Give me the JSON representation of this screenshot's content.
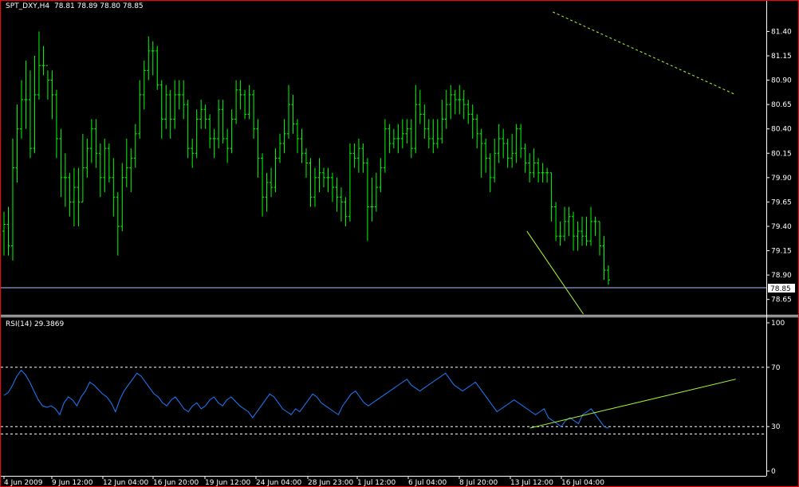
{
  "chart_data": [
    {
      "type": "bar",
      "subtype": "ohlc-bars",
      "header": {
        "symbol": "SPT_DXY,H4",
        "ohlc": "78.81 78.89 78.80 78.85"
      },
      "ylim": [
        78.5,
        81.6
      ],
      "y_ticks": [
        "81.40",
        "81.15",
        "80.90",
        "80.65",
        "80.40",
        "80.15",
        "79.90",
        "79.65",
        "79.40",
        "79.15",
        "78.90",
        "78.65"
      ],
      "current_price": "78.85",
      "series": [
        {
          "values": [
            79.42,
            79.2,
            80.0,
            80.4,
            80.7,
            80.7,
            80.2,
            80.75,
            81.05,
            81.05,
            80.9,
            80.75,
            80.3,
            79.9,
            79.9,
            79.65,
            79.8,
            79.65,
            80.0,
            80.2,
            80.4,
            80.15,
            79.9,
            80.2,
            79.9,
            79.7,
            79.4,
            79.9,
            80.0,
            80.1,
            80.35,
            80.75,
            81.0,
            81.2,
            81.2,
            80.85,
            80.5,
            80.75,
            80.5,
            80.75,
            80.75,
            80.65,
            80.2,
            80.15,
            80.5,
            80.6,
            80.5,
            80.3,
            80.3,
            80.6,
            80.3,
            80.2,
            80.5,
            80.8,
            80.75,
            80.55,
            80.75,
            80.4,
            80.1,
            79.7,
            79.85,
            79.8,
            80.1,
            80.25,
            80.35,
            80.65,
            80.45,
            80.3,
            80.15,
            80.05,
            79.7,
            79.9,
            79.95,
            79.9,
            79.9,
            79.8,
            79.7,
            79.65,
            79.5,
            80.15,
            80.1,
            80.2,
            80.05,
            79.6,
            79.6,
            79.8,
            80.0,
            80.4,
            80.25,
            80.3,
            80.3,
            80.35,
            80.4,
            80.2,
            80.65,
            80.55,
            80.4,
            80.3,
            80.25,
            80.3,
            80.5,
            80.65,
            80.75,
            80.7,
            80.7,
            80.65,
            80.55,
            80.5,
            80.35,
            80.25,
            80.1,
            79.9,
            80.15,
            80.3,
            80.25,
            80.1,
            80.15,
            80.4,
            80.2,
            80.05,
            79.95,
            80.05,
            79.95,
            79.95,
            79.95,
            79.6,
            79.3,
            79.3,
            79.45,
            79.5,
            79.3,
            79.35,
            79.3,
            79.25,
            79.45,
            79.45,
            79.2,
            78.95,
            78.85
          ]
        }
      ],
      "candles": [
        [
          79.35,
          79.55,
          79.1,
          79.42
        ],
        [
          79.42,
          79.6,
          79.1,
          79.2
        ],
        [
          79.2,
          80.3,
          79.05,
          80.0
        ],
        [
          80.0,
          80.65,
          79.85,
          80.4
        ],
        [
          80.4,
          80.9,
          80.3,
          80.7
        ],
        [
          80.7,
          81.1,
          80.4,
          80.7
        ],
        [
          80.7,
          81.0,
          80.1,
          80.2
        ],
        [
          80.2,
          81.15,
          80.15,
          80.75
        ],
        [
          80.75,
          81.4,
          80.7,
          81.05
        ],
        [
          81.05,
          81.25,
          80.95,
          81.05
        ],
        [
          81.05,
          81.0,
          80.7,
          80.9
        ],
        [
          80.9,
          81.0,
          80.5,
          80.75
        ],
        [
          80.75,
          80.8,
          80.1,
          80.3
        ],
        [
          80.3,
          80.4,
          79.7,
          79.9
        ],
        [
          79.9,
          80.15,
          79.6,
          79.9
        ],
        [
          79.9,
          79.95,
          79.5,
          79.65
        ],
        [
          79.65,
          80.0,
          79.4,
          79.8
        ],
        [
          79.8,
          80.0,
          79.4,
          79.65
        ],
        [
          79.65,
          80.35,
          79.65,
          80.0
        ],
        [
          80.0,
          80.3,
          79.9,
          80.2
        ],
        [
          80.2,
          80.5,
          80.05,
          80.4
        ],
        [
          80.4,
          80.5,
          80.0,
          80.15
        ],
        [
          80.15,
          80.25,
          79.7,
          79.9
        ],
        [
          79.9,
          80.3,
          79.75,
          80.2
        ],
        [
          80.2,
          80.25,
          79.85,
          79.9
        ],
        [
          79.9,
          80.1,
          79.5,
          79.7
        ],
        [
          79.7,
          79.75,
          79.1,
          79.4
        ],
        [
          79.4,
          80.05,
          79.35,
          79.9
        ],
        [
          79.9,
          80.3,
          79.8,
          80.0
        ],
        [
          80.0,
          80.2,
          79.75,
          80.1
        ],
        [
          80.1,
          80.45,
          80.0,
          80.35
        ],
        [
          80.35,
          80.9,
          80.3,
          80.75
        ],
        [
          80.75,
          81.1,
          80.6,
          81.0
        ],
        [
          81.0,
          81.35,
          80.9,
          81.2
        ],
        [
          81.2,
          81.3,
          80.95,
          81.2
        ],
        [
          81.2,
          81.25,
          80.8,
          80.85
        ],
        [
          80.85,
          80.9,
          80.3,
          80.5
        ],
        [
          80.5,
          80.85,
          80.4,
          80.75
        ],
        [
          80.75,
          80.8,
          80.3,
          80.5
        ],
        [
          80.5,
          80.9,
          80.4,
          80.75
        ],
        [
          80.75,
          80.9,
          80.6,
          80.75
        ],
        [
          80.75,
          80.9,
          80.5,
          80.65
        ],
        [
          80.65,
          80.7,
          80.1,
          80.2
        ],
        [
          80.2,
          80.3,
          80.0,
          80.15
        ],
        [
          80.15,
          80.6,
          80.1,
          80.5
        ],
        [
          80.5,
          80.7,
          80.4,
          80.6
        ],
        [
          80.6,
          80.65,
          80.4,
          80.5
        ],
        [
          80.5,
          80.55,
          80.2,
          80.3
        ],
        [
          80.3,
          80.4,
          80.1,
          80.3
        ],
        [
          80.3,
          80.7,
          80.2,
          80.6
        ],
        [
          80.6,
          80.7,
          80.25,
          80.3
        ],
        [
          80.3,
          80.4,
          80.05,
          80.2
        ],
        [
          80.2,
          80.6,
          80.15,
          80.5
        ],
        [
          80.5,
          80.9,
          80.45,
          80.8
        ],
        [
          80.8,
          80.9,
          80.6,
          80.75
        ],
        [
          80.75,
          80.8,
          80.5,
          80.55
        ],
        [
          80.55,
          80.85,
          80.5,
          80.75
        ],
        [
          80.75,
          80.8,
          80.3,
          80.4
        ],
        [
          80.4,
          80.5,
          79.9,
          80.1
        ],
        [
          80.1,
          80.15,
          79.5,
          79.7
        ],
        [
          79.7,
          79.95,
          79.55,
          79.85
        ],
        [
          79.85,
          80.0,
          79.7,
          79.8
        ],
        [
          79.8,
          80.2,
          79.75,
          80.1
        ],
        [
          80.1,
          80.35,
          80.05,
          80.25
        ],
        [
          80.25,
          80.5,
          80.15,
          80.35
        ],
        [
          80.35,
          80.85,
          80.3,
          80.65
        ],
        [
          80.65,
          80.75,
          80.35,
          80.45
        ],
        [
          80.45,
          80.5,
          80.15,
          80.3
        ],
        [
          80.3,
          80.4,
          80.05,
          80.15
        ],
        [
          80.15,
          80.2,
          79.9,
          80.05
        ],
        [
          80.05,
          80.1,
          79.6,
          79.7
        ],
        [
          79.7,
          80.0,
          79.6,
          79.9
        ],
        [
          79.9,
          80.1,
          79.75,
          79.95
        ],
        [
          79.95,
          80.0,
          79.8,
          79.9
        ],
        [
          79.9,
          80.0,
          79.75,
          79.9
        ],
        [
          79.9,
          79.95,
          79.65,
          79.8
        ],
        [
          79.8,
          79.9,
          79.55,
          79.7
        ],
        [
          79.7,
          79.8,
          79.45,
          79.65
        ],
        [
          79.65,
          79.7,
          79.4,
          79.5
        ],
        [
          79.5,
          80.25,
          79.45,
          80.15
        ],
        [
          80.15,
          80.25,
          80.0,
          80.1
        ],
        [
          80.1,
          80.3,
          79.95,
          80.2
        ],
        [
          80.2,
          80.25,
          79.95,
          80.05
        ],
        [
          80.05,
          80.1,
          79.25,
          79.6
        ],
        [
          79.6,
          79.9,
          79.45,
          79.6
        ],
        [
          79.6,
          79.95,
          79.55,
          79.8
        ],
        [
          79.8,
          80.1,
          79.75,
          80.0
        ],
        [
          80.0,
          80.5,
          79.95,
          80.4
        ],
        [
          80.4,
          80.45,
          80.15,
          80.25
        ],
        [
          80.25,
          80.4,
          80.2,
          80.3
        ],
        [
          80.3,
          80.45,
          80.15,
          80.3
        ],
        [
          80.3,
          80.5,
          80.2,
          80.35
        ],
        [
          80.35,
          80.5,
          80.25,
          80.4
        ],
        [
          80.4,
          80.5,
          80.1,
          80.2
        ],
        [
          80.2,
          80.85,
          80.15,
          80.65
        ],
        [
          80.65,
          80.8,
          80.45,
          80.55
        ],
        [
          80.55,
          80.65,
          80.3,
          80.4
        ],
        [
          80.4,
          80.5,
          80.2,
          80.3
        ],
        [
          80.3,
          80.5,
          80.15,
          80.25
        ],
        [
          80.25,
          80.5,
          80.2,
          80.3
        ],
        [
          80.3,
          80.7,
          80.25,
          80.5
        ],
        [
          80.5,
          80.8,
          80.4,
          80.65
        ],
        [
          80.65,
          80.85,
          80.5,
          80.75
        ],
        [
          80.75,
          80.8,
          80.55,
          80.7
        ],
        [
          80.7,
          80.85,
          80.55,
          80.7
        ],
        [
          80.7,
          80.8,
          80.5,
          80.65
        ],
        [
          80.65,
          80.7,
          80.45,
          80.55
        ],
        [
          80.55,
          80.65,
          80.3,
          80.5
        ],
        [
          80.5,
          80.55,
          80.2,
          80.35
        ],
        [
          80.35,
          80.4,
          79.9,
          80.25
        ],
        [
          80.25,
          80.3,
          79.95,
          80.1
        ],
        [
          80.1,
          80.15,
          79.75,
          79.9
        ],
        [
          79.9,
          80.3,
          79.85,
          80.15
        ],
        [
          80.15,
          80.45,
          80.05,
          80.3
        ],
        [
          80.3,
          80.4,
          80.1,
          80.25
        ],
        [
          80.25,
          80.3,
          80.0,
          80.1
        ],
        [
          80.1,
          80.35,
          80.0,
          80.15
        ],
        [
          80.15,
          80.45,
          80.05,
          80.4
        ],
        [
          80.4,
          80.45,
          80.1,
          80.2
        ],
        [
          80.2,
          80.25,
          79.95,
          80.05
        ],
        [
          80.05,
          80.15,
          79.85,
          79.95
        ],
        [
          79.95,
          80.2,
          79.9,
          80.05
        ],
        [
          80.05,
          80.1,
          79.85,
          79.95
        ],
        [
          79.95,
          80.05,
          79.85,
          79.95
        ],
        [
          79.95,
          80.0,
          79.85,
          79.95
        ],
        [
          79.95,
          79.95,
          79.45,
          79.6
        ],
        [
          79.6,
          79.65,
          79.25,
          79.3
        ],
        [
          79.3,
          79.45,
          79.2,
          79.3
        ],
        [
          79.3,
          79.6,
          79.25,
          79.45
        ],
        [
          79.45,
          79.6,
          79.3,
          79.5
        ],
        [
          79.5,
          79.55,
          79.15,
          79.3
        ],
        [
          79.3,
          79.45,
          79.15,
          79.35
        ],
        [
          79.35,
          79.5,
          79.2,
          79.3
        ],
        [
          79.3,
          79.5,
          79.2,
          79.25
        ],
        [
          79.25,
          79.6,
          79.2,
          79.45
        ],
        [
          79.45,
          79.5,
          79.3,
          79.45
        ],
        [
          79.45,
          79.45,
          79.1,
          79.2
        ],
        [
          79.2,
          79.3,
          78.85,
          78.95
        ],
        [
          78.95,
          79.0,
          78.8,
          78.85
        ]
      ],
      "trendlines": [
        {
          "from": [
            0.72,
            81.6
          ],
          "to": [
            0.96,
            80.75
          ],
          "style": "dashed"
        },
        {
          "from": [
            0.686,
            79.35
          ],
          "to": [
            0.76,
            78.5
          ],
          "style": "solid"
        }
      ]
    },
    {
      "type": "line",
      "title": "RSI(14) 29.3869",
      "ylim": [
        0,
        100
      ],
      "y_ticks": [
        "100",
        "70",
        "30",
        "0"
      ],
      "levels": [
        70,
        30,
        25
      ],
      "series": [
        {
          "values": [
            51,
            53,
            58,
            64,
            68,
            65,
            60,
            54,
            48,
            44,
            43,
            44,
            42,
            38,
            46,
            50,
            48,
            44,
            50,
            54,
            60,
            58,
            55,
            52,
            50,
            46,
            40,
            48,
            54,
            58,
            62,
            66,
            64,
            60,
            56,
            52,
            50,
            46,
            44,
            48,
            50,
            46,
            42,
            40,
            44,
            46,
            42,
            44,
            48,
            50,
            46,
            44,
            48,
            50,
            47,
            44,
            42,
            40,
            36,
            40,
            44,
            48,
            52,
            50,
            46,
            42,
            40,
            38,
            42,
            40,
            44,
            48,
            52,
            50,
            46,
            44,
            42,
            40,
            38,
            44,
            48,
            52,
            54,
            50,
            46,
            44,
            46,
            48,
            50,
            52,
            54,
            56,
            58,
            60,
            62,
            58,
            56,
            54,
            56,
            58,
            60,
            62,
            64,
            66,
            62,
            58,
            56,
            54,
            56,
            58,
            60,
            56,
            52,
            48,
            44,
            40,
            42,
            44,
            46,
            48,
            46,
            44,
            42,
            40,
            38,
            40,
            42,
            36,
            34,
            32,
            30,
            34,
            36,
            34,
            32,
            38,
            40,
            42,
            38,
            34,
            30,
            29
          ]
        }
      ],
      "trendlines": [
        {
          "from": [
            0.69,
            29
          ],
          "to": [
            0.96,
            62
          ],
          "style": "solid"
        }
      ]
    }
  ],
  "x_ticks": [
    "4 Jun 2009",
    "9 Jun 12:00",
    "12 Jun 04:00",
    "16 Jun 20:00",
    "19 Jun 12:00",
    "24 Jun 04:00",
    "28 Jun 23:00",
    "1 Jul 12:00",
    "6 Jul 04:00",
    "8 Jul 20:00",
    "13 Jul 12:00",
    "16 Jul 04:00"
  ],
  "colors": {
    "background": "#000000",
    "border": "#ff0000",
    "price_bars": "#00ff00",
    "rsi_line": "#1e7dff",
    "trendline": "#adff2f",
    "grid_level": "#ffffff",
    "price_line": "#a6c8ff"
  }
}
